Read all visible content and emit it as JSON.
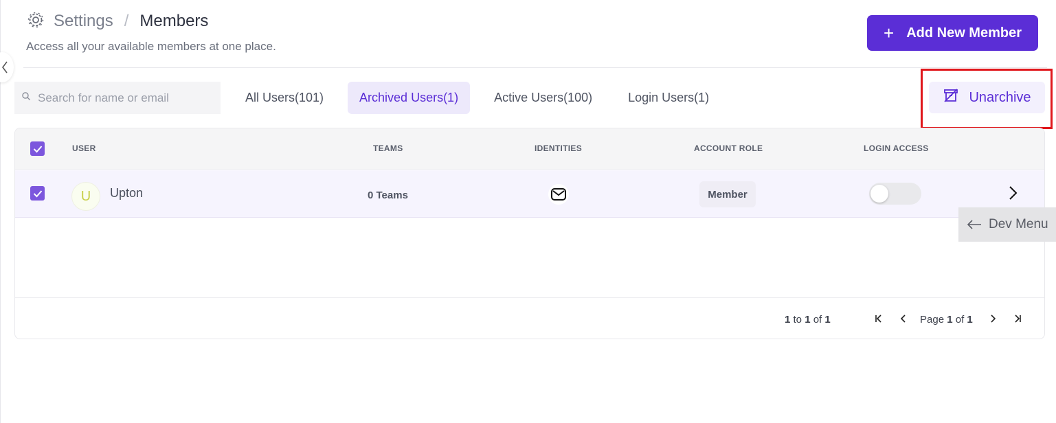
{
  "header": {
    "breadcrumb_root": "Settings",
    "breadcrumb_separator": "/",
    "breadcrumb_current": "Members",
    "subtitle": "Access all your available members at one place."
  },
  "actions": {
    "add_member_label": "Add New Member",
    "unarchive_label": "Unarchive"
  },
  "search": {
    "placeholder": "Search for name or email",
    "value": ""
  },
  "tabs": [
    {
      "label": "All Users(101)",
      "active": false
    },
    {
      "label": "Archived Users(1)",
      "active": true
    },
    {
      "label": "Active Users(100)",
      "active": false
    },
    {
      "label": "Login Users(1)",
      "active": false
    }
  ],
  "table": {
    "columns": {
      "user": "USER",
      "teams": "TEAMS",
      "identities": "IDENTITIES",
      "account_role": "ACCOUNT ROLE",
      "login_access": "LOGIN ACCESS"
    },
    "rows": [
      {
        "avatar_initial": "U",
        "name": "Upton",
        "teams": "0 Teams",
        "identity_icon": "mail-icon",
        "role": "Member",
        "login_access": false,
        "selected": true
      }
    ],
    "select_all": true
  },
  "pagination": {
    "range_start": "1",
    "range_to": "to",
    "range_end": "1",
    "range_of": "of",
    "total": "1",
    "page_label": "Page",
    "page_current": "1",
    "page_of": "of",
    "page_total": "1"
  },
  "dev_menu": {
    "label": "Dev Menu"
  },
  "colors": {
    "primary": "#5b2ed6",
    "active_tab_bg": "#ede9fb",
    "checkbox": "#7c56dd",
    "highlight_outline": "#e0161b"
  }
}
